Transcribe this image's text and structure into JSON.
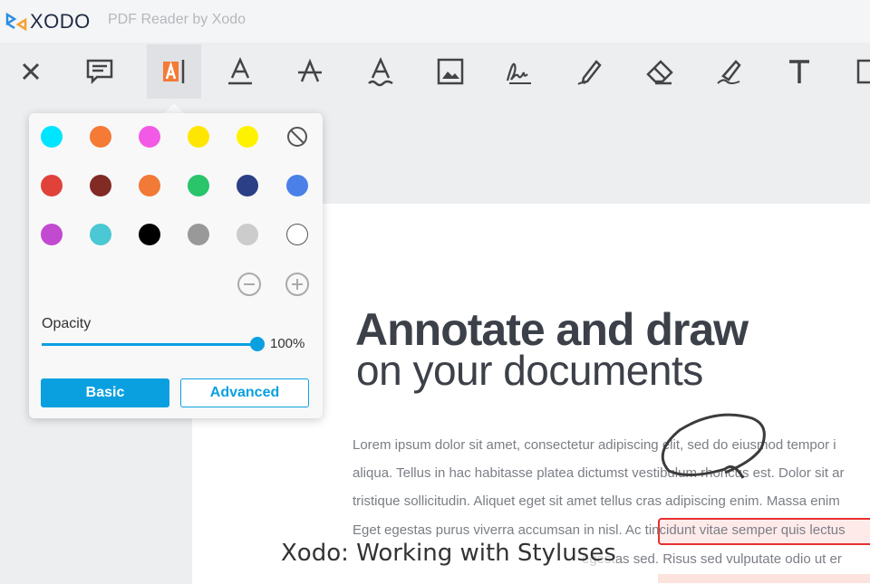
{
  "app": {
    "logo": "XODO",
    "subtitle": "PDF Reader by Xodo"
  },
  "toolbar": [
    "close-icon",
    "comment-icon",
    "text-highlight-icon",
    "text-underline-icon",
    "text-strikeout-icon",
    "text-squiggly-icon",
    "image-icon",
    "signature-icon",
    "freehand-pen-icon",
    "eraser-icon",
    "freehand-highlight-icon",
    "free-text-icon",
    "rectangle-icon"
  ],
  "popup": {
    "colors": [
      "#00e5ff",
      "#f47a36",
      "#f25ae6",
      "#ffe600",
      "#fff200",
      "none",
      "#e0423a",
      "#822a24",
      "#f07a36",
      "#2ac46a",
      "#2a3f85",
      "#4a80e8",
      "#c14ad0",
      "#4ac8d4",
      "#000000",
      "#999999",
      "#cccccc",
      "#ffffff"
    ],
    "opacity_label": "Opacity",
    "opacity_value": "100%",
    "opacity": 1.0,
    "basic": "Basic",
    "advanced": "Advanced"
  },
  "doc": {
    "title1": "Annotate and draw",
    "title2": "on your documents",
    "lines": [
      "Lorem ipsum dolor sit amet, consectetur adipiscing elit, sed do eiusmod tempor i",
      "aliqua. Tellus in hac habitasse platea dictumst vestibulum rhoncus est. Dolor sit ar",
      "tristique sollicitudin. Aliquet eget sit amet tellus cras adipiscing enim. Massa enim",
      "Eget egestas purus viverra accumsan in nisl. Ac tincidunt vitae semper quis lectus",
      "egestas sed. Risus sed vulputate odio ut er"
    ]
  },
  "caption": "Xodo: Working with Styluses"
}
